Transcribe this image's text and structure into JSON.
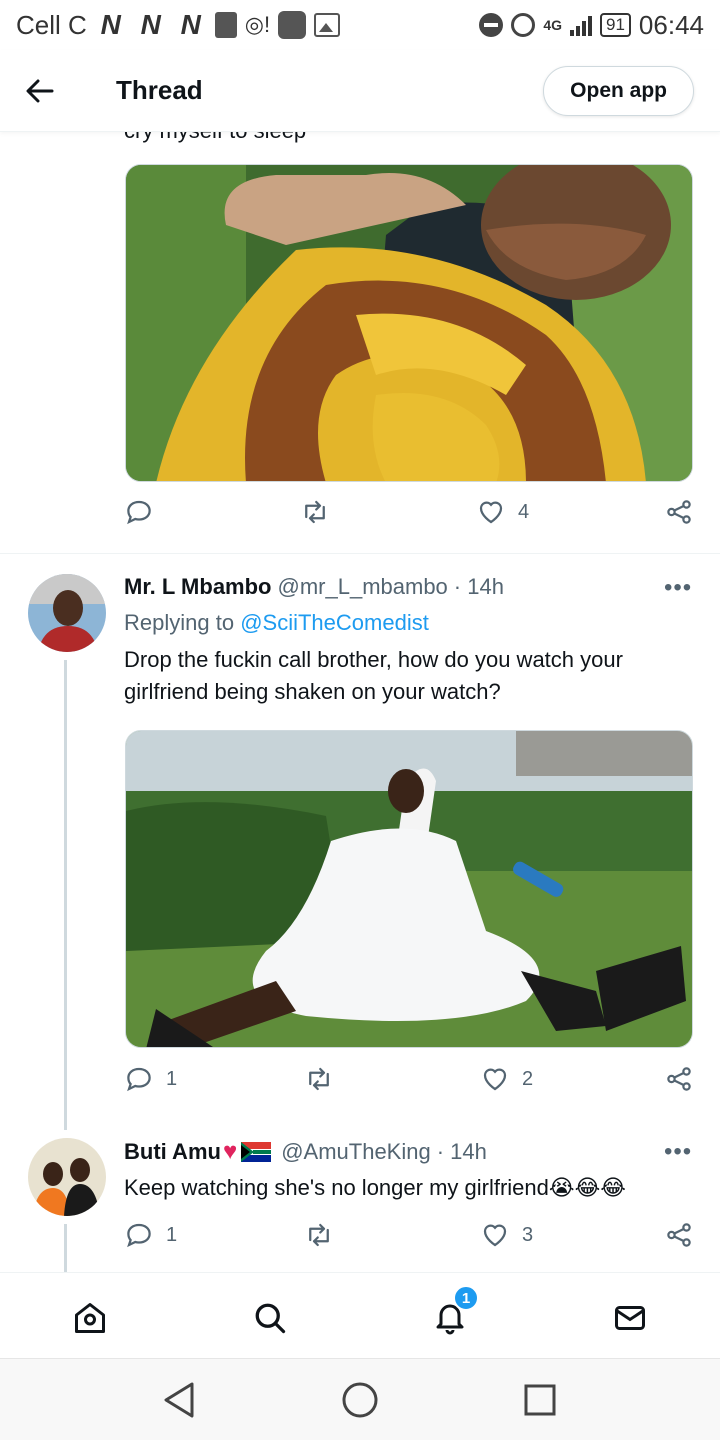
{
  "status_bar": {
    "carrier": "Cell C",
    "network_marks": [
      "N",
      "N",
      "N"
    ],
    "signal_type": "4G",
    "battery": "91",
    "time": "06:44"
  },
  "header": {
    "title": "Thread",
    "open_app_label": "Open app"
  },
  "prev_tweet": {
    "cut_text": "cry myself to sleep",
    "image_alt": "Man holding a large honeycomb",
    "reply_count": "",
    "retweet_count": "",
    "like_count": "4"
  },
  "tweets": [
    {
      "name": "Mr. L Mbambo",
      "handle": "@mr_L_mbambo",
      "time": "· 14h",
      "replying_prefix": "Replying to",
      "replying_to": "@SciiTheComedist",
      "text": "Drop the fuckin call brother, how do you watch your girlfriend being shaken on your watch?",
      "image_alt": "Bride in white dress sitting on grass",
      "reply_count": "1",
      "retweet_count": "",
      "like_count": "2"
    },
    {
      "name": "Buti Amu",
      "handle": "@AmuTheKing",
      "time": "· 14h",
      "text": "Keep watching she's no longer my girlfriend😭😂😂",
      "reply_count": "1",
      "retweet_count": "",
      "like_count": "3"
    }
  ],
  "more_glyph": "•••",
  "bottom_nav": {
    "items": [
      "home-icon",
      "search-icon",
      "notifications-icon",
      "messages-icon"
    ],
    "notification_badge": "1"
  },
  "colors": {
    "accent": "#1d9bf0",
    "text_secondary": "#536471",
    "border": "#cfd9de"
  }
}
